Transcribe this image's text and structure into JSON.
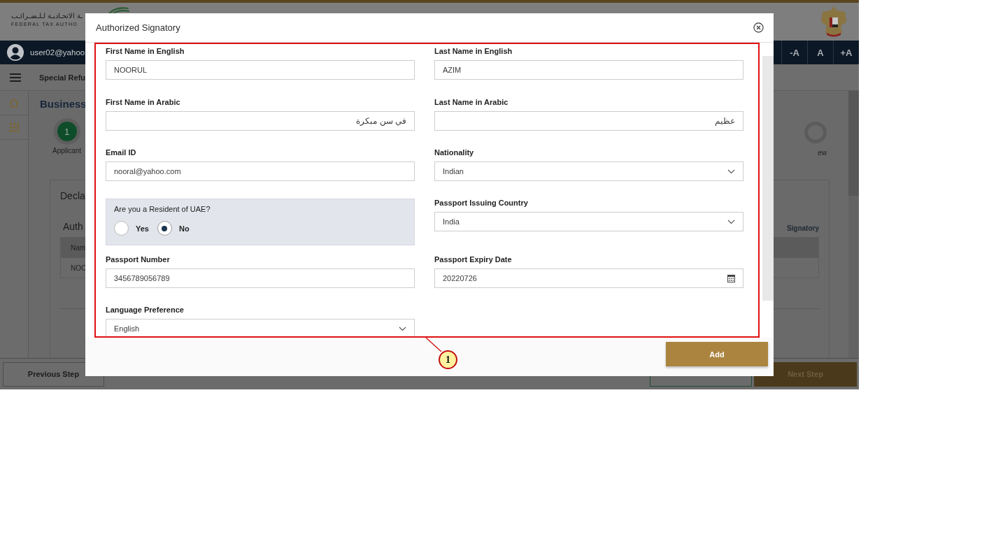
{
  "background": {
    "logo_arabic": "ـة الاتحـاديـة لـلـضـرائـب",
    "logo_english": "FEDERAL TAX AUTHO",
    "user": "user02@yahoo",
    "font_buttons": [
      "-A",
      "A",
      "+A"
    ],
    "breadcrumb": "Special Refu",
    "page_title": "Business",
    "step_number": "1",
    "step_label": "Applicant",
    "last_step_label": "ew",
    "section_title": "Decla",
    "table_title": "Auth",
    "side_heading": "Signatory",
    "table_header": "Nam",
    "table_cell": "NOO",
    "previous_button": "Previous Step",
    "next_button": "Next Step"
  },
  "dialog": {
    "title": "Authorized Signatory",
    "fields": [
      {
        "kind": "text",
        "label": "First Name in English",
        "value": "NOORUL"
      },
      {
        "kind": "text",
        "label": "Last Name in English",
        "value": "AZIM"
      },
      {
        "kind": "arabic",
        "label": "First Name in Arabic",
        "value": "في سن مبكرة"
      },
      {
        "kind": "arabic",
        "label": "Last Name in Arabic",
        "value": "عظيم"
      },
      {
        "kind": "text",
        "label": "Email ID",
        "value": "nooral@yahoo.com"
      },
      {
        "kind": "select",
        "label": "Nationality",
        "value": "Indian"
      },
      {
        "kind": "radio",
        "label": "Are you a Resident of UAE?",
        "options": [
          {
            "label": "Yes",
            "selected": false
          },
          {
            "label": "No",
            "selected": true
          }
        ]
      },
      {
        "kind": "select",
        "label": "Passport Issuing Country",
        "value": "India"
      },
      {
        "kind": "text",
        "label": "Passport Number",
        "value": "3456789056789"
      },
      {
        "kind": "date",
        "label": "Passport Expiry Date",
        "value": "20220726"
      },
      {
        "kind": "select",
        "label": "Language Preference",
        "value": "English"
      }
    ],
    "add_button": "Add"
  },
  "annotation": {
    "number": "1"
  }
}
